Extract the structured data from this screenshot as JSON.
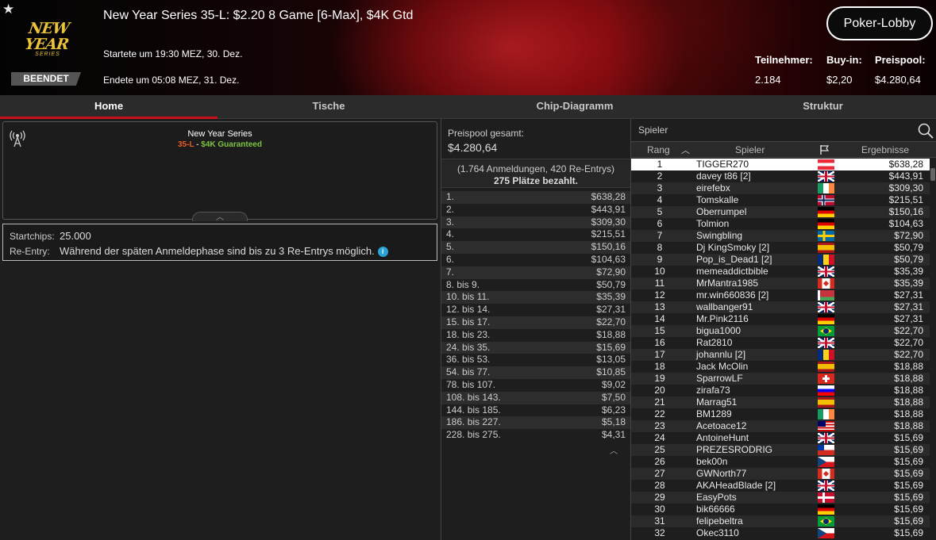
{
  "header": {
    "series_logo_line1": "NEW YEAR",
    "series_logo_line2": "SERIES",
    "status": "BEENDET",
    "title": "New Year Series 35-L: $2.20 8 Game [6-Max], $4K Gtd",
    "started": "Startete um 19:30 MEZ, 30. Dez.",
    "ended": "Endete um 05:08 MEZ, 31. Dez.",
    "lobby_button": "Poker-Lobby",
    "players_label": "Teilnehmer:",
    "players_value": "2.184",
    "buyin_label": "Buy-in:",
    "buyin_value": "$2,20",
    "prizepool_label": "Preispool:",
    "prizepool_value": "$4.280,64"
  },
  "tabs": [
    "Home",
    "Tische",
    "Chip-Diagramm",
    "Struktur"
  ],
  "active_tab": "Home",
  "info": {
    "series_name": "New Year Series",
    "event_code": "35-L",
    "dash": " - ",
    "guarantee": "$4K Guaranteed",
    "startchips_label": "Startchips:",
    "startchips_value": "25.000",
    "reentry_label": "Re-Entry:",
    "reentry_value": "Während der späten Anmeldephase sind bis zu 3 Re-Entrys möglich.",
    "info_icon": "i"
  },
  "prizepool": {
    "label": "Preispool gesamt:",
    "value": "$4.280,64",
    "entries_text": "(1.764 Anmeldungen, 420 Re-Entrys)",
    "paid_text": "275 Plätze bezahlt.",
    "rows": [
      {
        "place": "1.",
        "prize": "$638,28"
      },
      {
        "place": "2.",
        "prize": "$443,91"
      },
      {
        "place": "3.",
        "prize": "$309,30"
      },
      {
        "place": "4.",
        "prize": "$215,51"
      },
      {
        "place": "5.",
        "prize": "$150,16"
      },
      {
        "place": "6.",
        "prize": "$104,63"
      },
      {
        "place": "7.",
        "prize": "$72,90"
      },
      {
        "place": "8. bis 9.",
        "prize": "$50,79"
      },
      {
        "place": "10. bis 11.",
        "prize": "$35,39"
      },
      {
        "place": "12. bis 14.",
        "prize": "$27,31"
      },
      {
        "place": "15. bis 17.",
        "prize": "$22,70"
      },
      {
        "place": "18. bis 23.",
        "prize": "$18,88"
      },
      {
        "place": "24. bis 35.",
        "prize": "$15,69"
      },
      {
        "place": "36. bis 53.",
        "prize": "$13,05"
      },
      {
        "place": "54. bis 77.",
        "prize": "$10,85"
      },
      {
        "place": "78. bis 107.",
        "prize": "$9,02"
      },
      {
        "place": "108. bis 143.",
        "prize": "$7,50"
      },
      {
        "place": "144. bis 185.",
        "prize": "$6,23"
      },
      {
        "place": "186. bis 227.",
        "prize": "$5,18"
      },
      {
        "place": "228. bis 275.",
        "prize": "$4,31"
      }
    ]
  },
  "players": {
    "search_placeholder": "Spieler",
    "col_rank": "Rang",
    "col_player": "Spieler",
    "col_result": "Ergebnisse",
    "sort_icon": "sort-ascending-icon",
    "flag_col_icon": "flag-icon",
    "rows": [
      {
        "rank": "1",
        "name": "TIGGER270",
        "flag": "at",
        "result": "$638,28"
      },
      {
        "rank": "2",
        "name": "davey t86 [2]",
        "flag": "uk",
        "result": "$443,91"
      },
      {
        "rank": "3",
        "name": "eirefebx",
        "flag": "ie",
        "result": "$309,30"
      },
      {
        "rank": "4",
        "name": "Tomskalle",
        "flag": "no",
        "result": "$215,51"
      },
      {
        "rank": "5",
        "name": "Oberrumpel",
        "flag": "de",
        "result": "$150,16"
      },
      {
        "rank": "6",
        "name": "Tolmion",
        "flag": "de",
        "result": "$104,63"
      },
      {
        "rank": "7",
        "name": "Swingbling",
        "flag": "se",
        "result": "$72,90"
      },
      {
        "rank": "8",
        "name": "Dj KingSmoky [2]",
        "flag": "es",
        "result": "$50,79"
      },
      {
        "rank": "9",
        "name": "Pop_is_Dead1 [2]",
        "flag": "ro",
        "result": "$50,79"
      },
      {
        "rank": "10",
        "name": "memeaddictbible",
        "flag": "uk",
        "result": "$35,39"
      },
      {
        "rank": "11",
        "name": "MrMantra1985",
        "flag": "ca",
        "result": "$35,39"
      },
      {
        "rank": "12",
        "name": "mr.win660836 [2]",
        "flag": "by",
        "result": "$27,31"
      },
      {
        "rank": "13",
        "name": "wallbanger91",
        "flag": "uk",
        "result": "$27,31"
      },
      {
        "rank": "14",
        "name": "Mr.Pink2116",
        "flag": "de",
        "result": "$27,31"
      },
      {
        "rank": "15",
        "name": "bigua1000",
        "flag": "br",
        "result": "$22,70"
      },
      {
        "rank": "16",
        "name": "Rat2810",
        "flag": "uk",
        "result": "$22,70"
      },
      {
        "rank": "17",
        "name": "johannlu [2]",
        "flag": "ro",
        "result": "$22,70"
      },
      {
        "rank": "18",
        "name": "Jack McOlin",
        "flag": "es",
        "result": "$18,88"
      },
      {
        "rank": "19",
        "name": "SparrowLF",
        "flag": "ch",
        "result": "$18,88"
      },
      {
        "rank": "20",
        "name": "zirafa73",
        "flag": "si",
        "result": "$18,88"
      },
      {
        "rank": "21",
        "name": "Marrag51",
        "flag": "es",
        "result": "$18,88"
      },
      {
        "rank": "22",
        "name": "BM1289",
        "flag": "ie",
        "result": "$18,88"
      },
      {
        "rank": "23",
        "name": "Acetoace12",
        "flag": "my",
        "result": "$18,88"
      },
      {
        "rank": "24",
        "name": "AntoineHunt",
        "flag": "uk",
        "result": "$15,69"
      },
      {
        "rank": "25",
        "name": "PREZESRODRIG",
        "flag": "cl",
        "result": "$15,69"
      },
      {
        "rank": "26",
        "name": "bek00n",
        "flag": "cz",
        "result": "$15,69"
      },
      {
        "rank": "27",
        "name": "GWNorth77",
        "flag": "ca",
        "result": "$15,69"
      },
      {
        "rank": "28",
        "name": "AKAHeadBlade [2]",
        "flag": "uk",
        "result": "$15,69"
      },
      {
        "rank": "29",
        "name": "EasyPots",
        "flag": "dk-f",
        "result": "$15,69"
      },
      {
        "rank": "30",
        "name": "bik66666",
        "flag": "de",
        "result": "$15,69"
      },
      {
        "rank": "31",
        "name": "felipebeltra",
        "flag": "br",
        "result": "$15,69"
      },
      {
        "rank": "32",
        "name": "Okec3110",
        "flag": "cz",
        "result": "$15,69"
      }
    ]
  },
  "colors": {
    "accent_red": "#c8101c",
    "event_code_orange": "#e85c1e",
    "guarantee_green": "#7dc242",
    "info_blue": "#2aa3d8"
  }
}
